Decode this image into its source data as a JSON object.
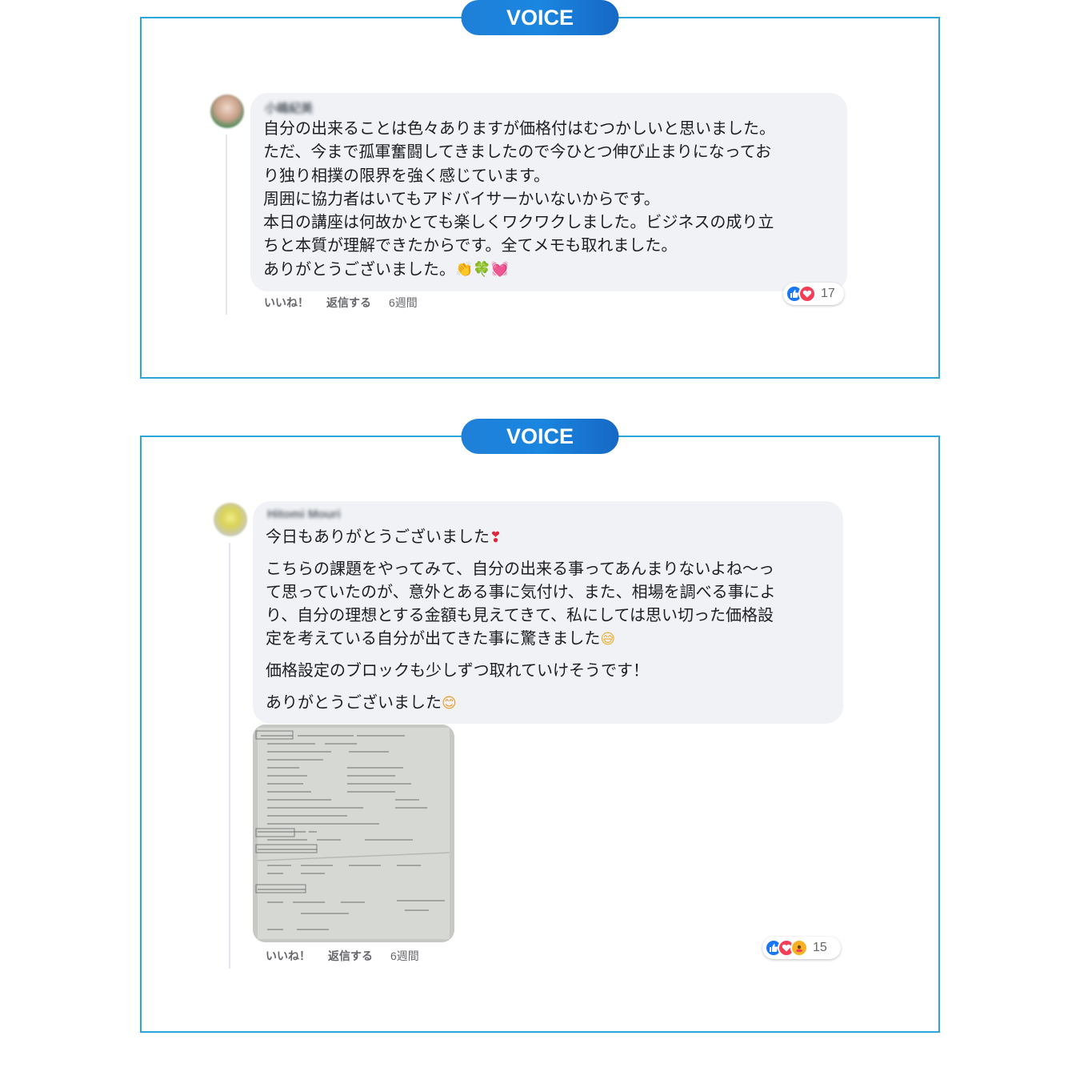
{
  "cards": [
    {
      "badge": "VOICE",
      "comment": {
        "author": "小嶋紀美",
        "lines": [
          "自分の出来ることは色々ありますが価格付はむつかしいと思いました。",
          "ただ、今まで孤軍奮闘してきましたので今ひとつ伸び止まりになってお",
          "り独り相撲の限界を強く感じています。",
          "周囲に協力者はいてもアドバイサーかいないからです。",
          "本日の講座は何故かとても楽しくワクワクしました。ビジネスの成り立",
          "ちと本質が理解できたからです。全てメモも取れました。",
          "ありがとうございました。"
        ],
        "trailing_emojis": [
          "👏",
          "🍀",
          "💓"
        ],
        "emoji_names": [
          "clapping-hands-icon",
          "clover-icon",
          "heart-icon"
        ],
        "reactions": {
          "icons": [
            "like",
            "love"
          ],
          "count": "17"
        },
        "actions": {
          "like": "いいね！",
          "reply": "返信する",
          "time": "6週間"
        }
      }
    },
    {
      "badge": "VOICE",
      "comment": {
        "author": "Hitomi Mouri",
        "paragraphs": [
          {
            "lines": [
              "今日もありがとうございました"
            ],
            "emoji": "❣"
          },
          {
            "lines": [
              "こちらの課題をやってみて、自分の出来る事ってあんまりないよね〜っ",
              "て思っていたのが、意外とある事に気付け、また、相場を調べる事によ",
              "り、自分の理想とする金額も見えてきて、私にしては思い切った価格設",
              "定を考えている自分が出てきた事に驚きました"
            ],
            "emoji": "😅"
          },
          {
            "lines": [
              "価格設定のブロックも少しずつ取れていけそうです！"
            ],
            "emoji": ""
          },
          {
            "lines": [
              "ありがとうございました"
            ],
            "emoji": "😊"
          }
        ],
        "attachment_label": "handwritten-notes-photo",
        "reactions": {
          "icons": [
            "like",
            "love",
            "care"
          ],
          "count": "15"
        },
        "actions": {
          "like": "いいね！",
          "reply": "返信する",
          "time": "6週間"
        }
      }
    }
  ],
  "colors": {
    "card_border": "#2aa6d8",
    "badge_gradient_start": "#1f7fd8",
    "badge_gradient_end": "#1668c4",
    "bubble_bg": "#f0f2f5",
    "like_blue": "#1877f2",
    "love_red": "#f33e58",
    "care_yellow": "#f7b125"
  }
}
